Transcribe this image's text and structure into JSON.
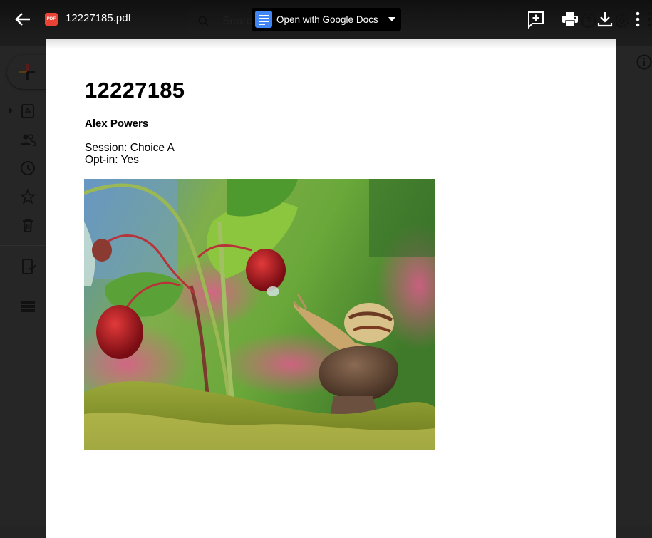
{
  "background": {
    "search_placeholder": "Search in Drive"
  },
  "viewer": {
    "file_name": "12227185.pdf",
    "file_type_badge": "PDF",
    "open_with_label": "Open with Google Docs",
    "toolbar": {
      "add_comment": "add-comment",
      "print": "print",
      "help": "help",
      "download": "download",
      "settings": "settings",
      "more": "more-actions"
    }
  },
  "document": {
    "title": "12227185",
    "name": "Alex Powers",
    "session_line": "Session: Choice A",
    "optin_line": "Opt-in: Yes",
    "image_alt": "Snail on mushroom beneath wild strawberries"
  }
}
